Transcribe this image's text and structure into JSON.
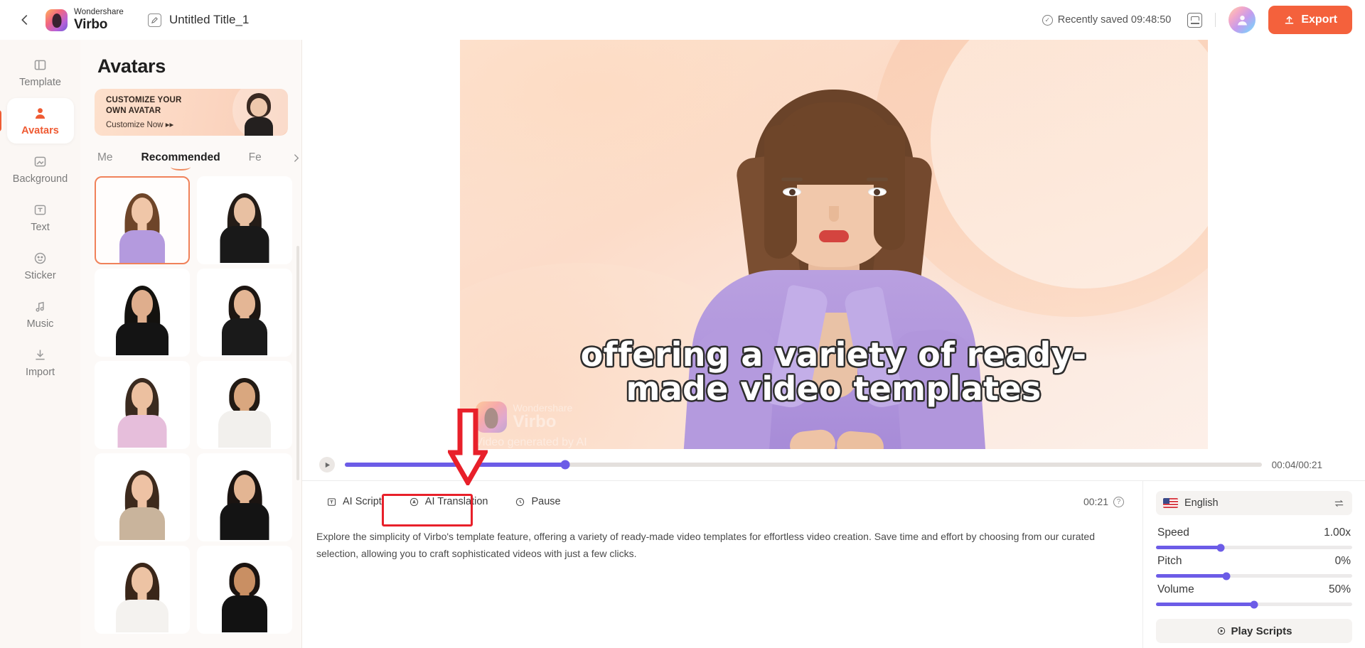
{
  "header": {
    "back_icon": "chevron-left-icon",
    "brand_top": "Wondershare",
    "brand_bottom": "Virbo",
    "edit_icon": "edit-pencil-icon",
    "doc_title": "Untitled Title_1",
    "saved_status": "Recently saved 09:48:50",
    "save_icon": "save-icon",
    "account_icon": "user-avatar-icon",
    "export_label": "Export",
    "export_icon": "upload-icon",
    "export_color": "#f4613c"
  },
  "rail": {
    "items": [
      {
        "label": "Template",
        "icon": "template-icon",
        "active": false
      },
      {
        "label": "Avatars",
        "icon": "avatars-person-icon",
        "active": true
      },
      {
        "label": "Background",
        "icon": "background-icon",
        "active": false
      },
      {
        "label": "Text",
        "icon": "text-icon",
        "active": false
      },
      {
        "label": "Sticker",
        "icon": "sticker-smiley-icon",
        "active": false
      },
      {
        "label": "Music",
        "icon": "music-note-icon",
        "active": false
      },
      {
        "label": "Import",
        "icon": "import-download-icon",
        "active": false
      }
    ],
    "active_color": "#ef5b33"
  },
  "panel": {
    "title": "Avatars",
    "promo": {
      "heading_line1": "CUSTOMIZE YOUR",
      "heading_line2": "OWN AVATAR",
      "cta": "Customize Now",
      "cta_icon": "double-chevron-right-icon"
    },
    "tabs": [
      {
        "label": "Me",
        "active": false
      },
      {
        "label": "Recommended",
        "active": true
      },
      {
        "label": "Fe",
        "active": false
      }
    ],
    "tab_next_icon": "chevron-right-icon",
    "avatars": [
      {
        "name": "avatar-woman-purple-blazer",
        "selected": true,
        "hair": "#6e4529",
        "skin": "#f0c6a8",
        "outfit": "#b49ade",
        "hair_len": 54
      },
      {
        "name": "avatar-woman-black-blazer",
        "selected": false,
        "hair": "#241c17",
        "skin": "#e8c0a2",
        "outfit": "#191919",
        "hair_len": 50
      },
      {
        "name": "avatar-woman-black-hijab",
        "selected": false,
        "hair": "#14120f",
        "skin": "#dfae8d",
        "outfit": "#141414",
        "hair_len": 58
      },
      {
        "name": "avatar-woman-black-dress",
        "selected": false,
        "hair": "#1d1612",
        "skin": "#e4b695",
        "outfit": "#1a1a1a",
        "hair_len": 28
      },
      {
        "name": "avatar-woman-purple-beret",
        "selected": false,
        "hair": "#3a2a1f",
        "skin": "#ecc0a0",
        "outfit": "#e6bedb",
        "hair_len": 44
      },
      {
        "name": "avatar-man-white-shirt",
        "selected": false,
        "hair": "#221a14",
        "skin": "#d9a77f",
        "outfit": "#f2f0ed",
        "hair_len": 20
      },
      {
        "name": "avatar-woman-checkered",
        "selected": false,
        "hair": "#3d2a1d",
        "skin": "#eec2a4",
        "outfit": "#c9b49c",
        "hair_len": 50
      },
      {
        "name": "avatar-woman-black-top",
        "selected": false,
        "hair": "#1b1411",
        "skin": "#e3b593",
        "outfit": "#141414",
        "hair_len": 52
      },
      {
        "name": "avatar-woman-white-coat",
        "selected": false,
        "hair": "#3a2619",
        "skin": "#edc3a4",
        "outfit": "#f4f2ef",
        "hair_len": 46
      },
      {
        "name": "avatar-man-black-tank",
        "selected": false,
        "hair": "#1a1310",
        "skin": "#c98f63",
        "outfit": "#121212",
        "hair_len": 18
      }
    ]
  },
  "canvas": {
    "subtitle": "offering a variety of ready-made video templates",
    "watermark_top": "Wondershare",
    "watermark_brand": "Virbo",
    "watermark_note": "Video generated by AI"
  },
  "timeline": {
    "play_icon": "play-icon",
    "current_time": "00:04",
    "total_time": "00:21",
    "time_display": "00:04/00:21",
    "progress_percent": 24,
    "accent_color": "#6c5ce7"
  },
  "script": {
    "tools": [
      {
        "label": "AI Script",
        "icon": "ai-script-icon",
        "highlighted": false
      },
      {
        "label": "AI Translation",
        "icon": "ai-translation-icon",
        "highlighted": true
      },
      {
        "label": "Pause",
        "icon": "pause-clock-icon",
        "highlighted": false
      }
    ],
    "duration": "00:21",
    "help_icon": "question-mark-icon",
    "text": "Explore the simplicity of Virbo's template feature, offering a variety of ready-made video templates for effortless video creation. Save time and effort by choosing from our curated selection, allowing you to craft sophisticated videos with just a few clicks.",
    "highlight_color": "#e8202a"
  },
  "voice": {
    "language": "English",
    "flag_icon": "us-flag-icon",
    "swap_icon": "swap-arrows-icon",
    "controls": [
      {
        "label": "Speed",
        "value": "1.00x",
        "percent": 33
      },
      {
        "label": "Pitch",
        "value": "0%",
        "percent": 36
      },
      {
        "label": "Volume",
        "value": "50%",
        "percent": 50
      }
    ],
    "play_scripts_label": "Play Scripts",
    "play_scripts_icon": "play-circle-icon",
    "accent_color": "#6c5ce7"
  },
  "annotation": {
    "arrow_icon": "red-down-arrow-annotation",
    "color": "#e8202a"
  }
}
